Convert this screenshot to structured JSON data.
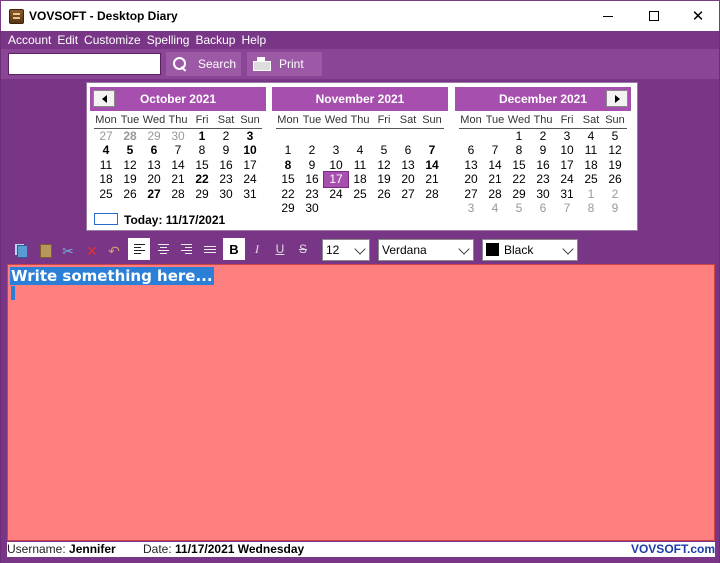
{
  "window": {
    "title": "VOVSOFT - Desktop Diary",
    "minimize_glyph": "—",
    "close_glyph": "✕"
  },
  "menu": [
    "Account",
    "Edit",
    "Customize",
    "Spelling",
    "Backup",
    "Help"
  ],
  "toolbar": {
    "search_value": "",
    "search_label": "Search",
    "print_label": "Print"
  },
  "calendar": {
    "weekday_headers": [
      "Mon",
      "Tue",
      "Wed",
      "Thu",
      "Fri",
      "Sat",
      "Sun"
    ],
    "months": [
      {
        "title": "October 2021",
        "days": [
          {
            "d": "27",
            "s": "o"
          },
          {
            "d": "28",
            "s": "ob"
          },
          {
            "d": "29",
            "s": "o"
          },
          {
            "d": "30",
            "s": "o"
          },
          {
            "d": "1",
            "s": "b"
          },
          {
            "d": "2",
            "s": ""
          },
          {
            "d": "3",
            "s": "b"
          },
          {
            "d": "4",
            "s": "b"
          },
          {
            "d": "5",
            "s": "b"
          },
          {
            "d": "6",
            "s": "b"
          },
          {
            "d": "7",
            "s": ""
          },
          {
            "d": "8",
            "s": ""
          },
          {
            "d": "9",
            "s": ""
          },
          {
            "d": "10",
            "s": "b"
          },
          {
            "d": "11",
            "s": ""
          },
          {
            "d": "12",
            "s": ""
          },
          {
            "d": "13",
            "s": ""
          },
          {
            "d": "14",
            "s": ""
          },
          {
            "d": "15",
            "s": ""
          },
          {
            "d": "16",
            "s": ""
          },
          {
            "d": "17",
            "s": ""
          },
          {
            "d": "18",
            "s": ""
          },
          {
            "d": "19",
            "s": ""
          },
          {
            "d": "20",
            "s": ""
          },
          {
            "d": "21",
            "s": ""
          },
          {
            "d": "22",
            "s": "b"
          },
          {
            "d": "23",
            "s": ""
          },
          {
            "d": "24",
            "s": ""
          },
          {
            "d": "25",
            "s": ""
          },
          {
            "d": "26",
            "s": ""
          },
          {
            "d": "27",
            "s": "b"
          },
          {
            "d": "28",
            "s": ""
          },
          {
            "d": "29",
            "s": ""
          },
          {
            "d": "30",
            "s": ""
          },
          {
            "d": "31",
            "s": ""
          }
        ]
      },
      {
        "title": "November 2021",
        "days": [
          {
            "d": "",
            "s": ""
          },
          {
            "d": "",
            "s": ""
          },
          {
            "d": "",
            "s": ""
          },
          {
            "d": "",
            "s": ""
          },
          {
            "d": "",
            "s": ""
          },
          {
            "d": "",
            "s": ""
          },
          {
            "d": "",
            "s": ""
          },
          {
            "d": "1",
            "s": ""
          },
          {
            "d": "2",
            "s": ""
          },
          {
            "d": "3",
            "s": ""
          },
          {
            "d": "4",
            "s": ""
          },
          {
            "d": "5",
            "s": ""
          },
          {
            "d": "6",
            "s": ""
          },
          {
            "d": "7",
            "s": "b"
          },
          {
            "d": "8",
            "s": "b"
          },
          {
            "d": "9",
            "s": ""
          },
          {
            "d": "10",
            "s": ""
          },
          {
            "d": "11",
            "s": ""
          },
          {
            "d": "12",
            "s": ""
          },
          {
            "d": "13",
            "s": ""
          },
          {
            "d": "14",
            "s": "b"
          },
          {
            "d": "15",
            "s": ""
          },
          {
            "d": "16",
            "s": ""
          },
          {
            "d": "17",
            "s": "t"
          },
          {
            "d": "18",
            "s": ""
          },
          {
            "d": "19",
            "s": ""
          },
          {
            "d": "20",
            "s": ""
          },
          {
            "d": "21",
            "s": ""
          },
          {
            "d": "22",
            "s": ""
          },
          {
            "d": "23",
            "s": ""
          },
          {
            "d": "24",
            "s": ""
          },
          {
            "d": "25",
            "s": ""
          },
          {
            "d": "26",
            "s": ""
          },
          {
            "d": "27",
            "s": ""
          },
          {
            "d": "28",
            "s": ""
          },
          {
            "d": "29",
            "s": ""
          },
          {
            "d": "30",
            "s": ""
          }
        ]
      },
      {
        "title": "December 2021",
        "days": [
          {
            "d": "",
            "s": ""
          },
          {
            "d": "",
            "s": ""
          },
          {
            "d": "1",
            "s": ""
          },
          {
            "d": "2",
            "s": ""
          },
          {
            "d": "3",
            "s": ""
          },
          {
            "d": "4",
            "s": ""
          },
          {
            "d": "5",
            "s": ""
          },
          {
            "d": "6",
            "s": ""
          },
          {
            "d": "7",
            "s": ""
          },
          {
            "d": "8",
            "s": ""
          },
          {
            "d": "9",
            "s": ""
          },
          {
            "d": "10",
            "s": ""
          },
          {
            "d": "11",
            "s": ""
          },
          {
            "d": "12",
            "s": ""
          },
          {
            "d": "13",
            "s": ""
          },
          {
            "d": "14",
            "s": ""
          },
          {
            "d": "15",
            "s": ""
          },
          {
            "d": "16",
            "s": ""
          },
          {
            "d": "17",
            "s": ""
          },
          {
            "d": "18",
            "s": ""
          },
          {
            "d": "19",
            "s": ""
          },
          {
            "d": "20",
            "s": ""
          },
          {
            "d": "21",
            "s": ""
          },
          {
            "d": "22",
            "s": ""
          },
          {
            "d": "23",
            "s": ""
          },
          {
            "d": "24",
            "s": ""
          },
          {
            "d": "25",
            "s": ""
          },
          {
            "d": "26",
            "s": ""
          },
          {
            "d": "27",
            "s": ""
          },
          {
            "d": "28",
            "s": ""
          },
          {
            "d": "29",
            "s": ""
          },
          {
            "d": "30",
            "s": ""
          },
          {
            "d": "31",
            "s": ""
          },
          {
            "d": "1",
            "s": "o"
          },
          {
            "d": "2",
            "s": "o"
          },
          {
            "d": "3",
            "s": "o"
          },
          {
            "d": "4",
            "s": "o"
          },
          {
            "d": "5",
            "s": "o"
          },
          {
            "d": "6",
            "s": "o"
          },
          {
            "d": "7",
            "s": "o"
          },
          {
            "d": "8",
            "s": "o"
          },
          {
            "d": "9",
            "s": "o"
          }
        ]
      }
    ],
    "today_label": "Today: 11/17/2021"
  },
  "format": {
    "cut_glyph": "✂",
    "delete_glyph": "✕",
    "undo_glyph": "↶",
    "bold_label": "B",
    "italic_label": "I",
    "underline_label": "U",
    "strike_label": "S",
    "font_size": "12",
    "font_name": "Verdana",
    "color_name": "Black"
  },
  "editor": {
    "text": "Write something here..."
  },
  "status": {
    "username_label": "Username:",
    "username": "Jennifer",
    "date_label": "Date:",
    "date": "11/17/2021 Wednesday",
    "brand": "VOVSOFT.com"
  },
  "colors": {
    "frame": "#7a3686",
    "calendar_header": "#a74fae",
    "editor_bg": "#ff7f7f",
    "selection": "#2b7fd6",
    "brand": "#1a3aa8"
  }
}
